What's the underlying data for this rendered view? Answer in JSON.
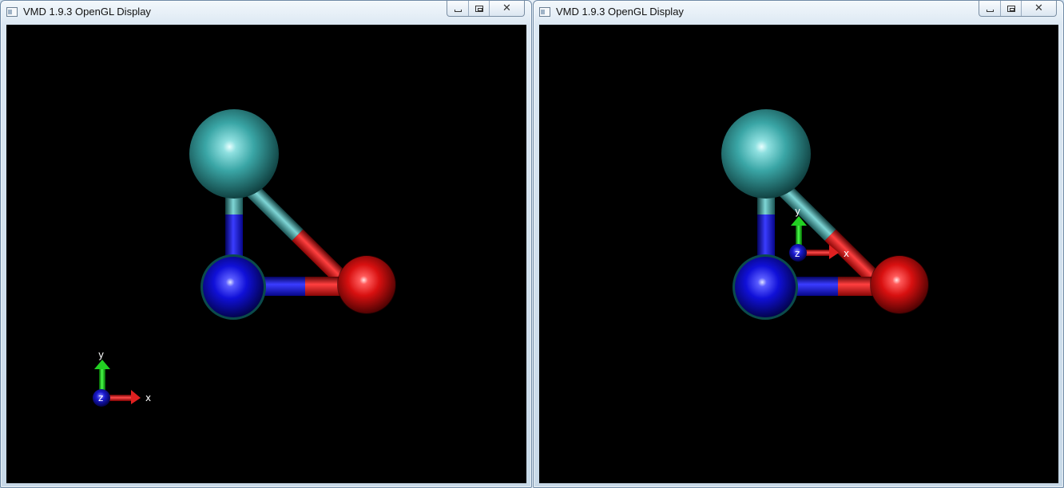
{
  "windows": [
    {
      "title": "VMD 1.9.3 OpenGL Display",
      "axes": {
        "x_label": "x",
        "y_label": "y",
        "z_label": "z"
      }
    },
    {
      "title": "VMD 1.9.3 OpenGL Display",
      "axes": {
        "x_label": "x",
        "y_label": "y",
        "z_label": "z"
      }
    }
  ],
  "molecule": {
    "atoms": [
      {
        "name": "cyan-atom",
        "color": "#3aa6a6"
      },
      {
        "name": "blue-atom",
        "color": "#1010d8"
      },
      {
        "name": "red-atom",
        "color": "#d81010"
      }
    ]
  },
  "colors": {
    "axis_x": "#d81010",
    "axis_y": "#10c010",
    "axis_z": "#1010c8",
    "viewport_bg": "#000000"
  }
}
